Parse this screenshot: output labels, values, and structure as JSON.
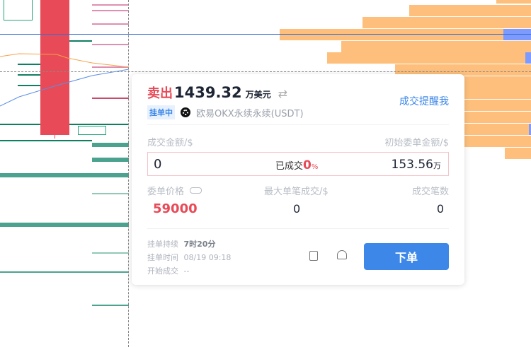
{
  "colors": {
    "sell": "#e84a57",
    "accent": "#3d87e8",
    "ask": "#fdbf7b",
    "bid": "#4ba38f",
    "marker": "#7d9bff"
  },
  "order": {
    "side": "卖出",
    "amount": "1439.32",
    "amount_unit": "万美元",
    "swap_icon": "swap-icon",
    "status_badge": "挂单中",
    "exchange": "欧易OKX永续永续(USDT)",
    "alert_link": "成交提醒我",
    "filled_amount_label": "成交金额/$",
    "initial_amount_label": "初始委单金额/$",
    "filled_amount": "0",
    "filled_pct_label": "已成交",
    "filled_pct": "0",
    "pct_sign": "%",
    "initial_amount": "153.56",
    "initial_unit": "万",
    "price_label": "委单价格",
    "max_fill_label": "最大单笔成交/$",
    "fill_count_label": "成交笔数",
    "price": "59000",
    "max_fill": "0",
    "fill_count": "0",
    "duration_label": "挂单持续",
    "duration": "7时20分",
    "time_label": "挂单时间",
    "time": "08/19 09:18",
    "start_label": "开始成交",
    "start": "--",
    "place_order": "下单"
  }
}
